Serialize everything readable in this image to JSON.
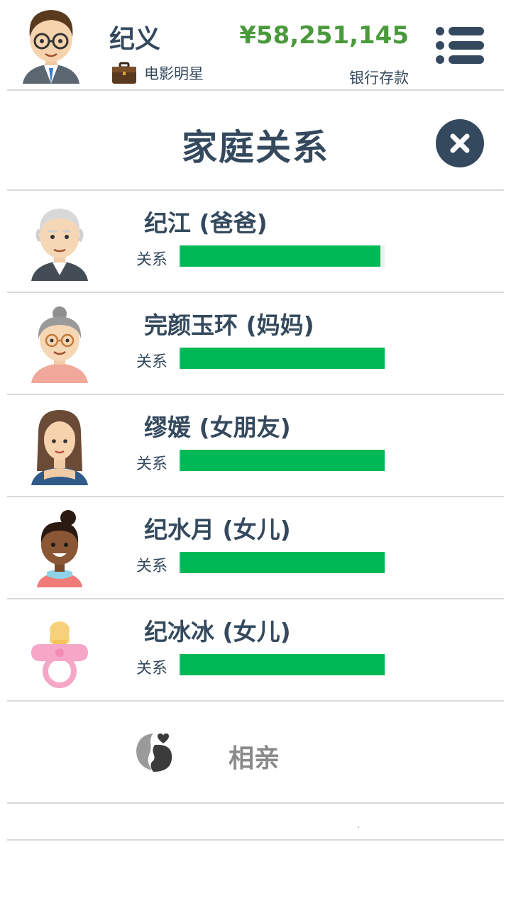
{
  "header": {
    "player_name": "纪义",
    "job_title": "电影明星",
    "money": "¥58,251,145",
    "money_label": "银行存款"
  },
  "page": {
    "title": "家庭关系"
  },
  "colors": {
    "text_dark": "#34495e",
    "money_green": "#4a9a3c",
    "bar_green": "#00b956",
    "muted_gray": "#8a8a8a"
  },
  "family": [
    {
      "name": "纪江 (爸爸)",
      "relation_label": "关系",
      "relation_level": 0.98,
      "avatar": "grandpa-avatar"
    },
    {
      "name": "完颜玉环 (妈妈)",
      "relation_label": "关系",
      "relation_level": 1.0,
      "avatar": "grandma-avatar"
    },
    {
      "name": "缪媛 (女朋友)",
      "relation_label": "关系",
      "relation_level": 1.0,
      "avatar": "girlfriend-avatar"
    },
    {
      "name": "纪水月 (女儿)",
      "relation_label": "关系",
      "relation_level": 1.0,
      "avatar": "girl-child-avatar"
    },
    {
      "name": "纪冰冰 (女儿)",
      "relation_label": "关系",
      "relation_level": 1.0,
      "avatar": "pacifier-avatar"
    }
  ],
  "actions": {
    "dating_label": "相亲"
  }
}
